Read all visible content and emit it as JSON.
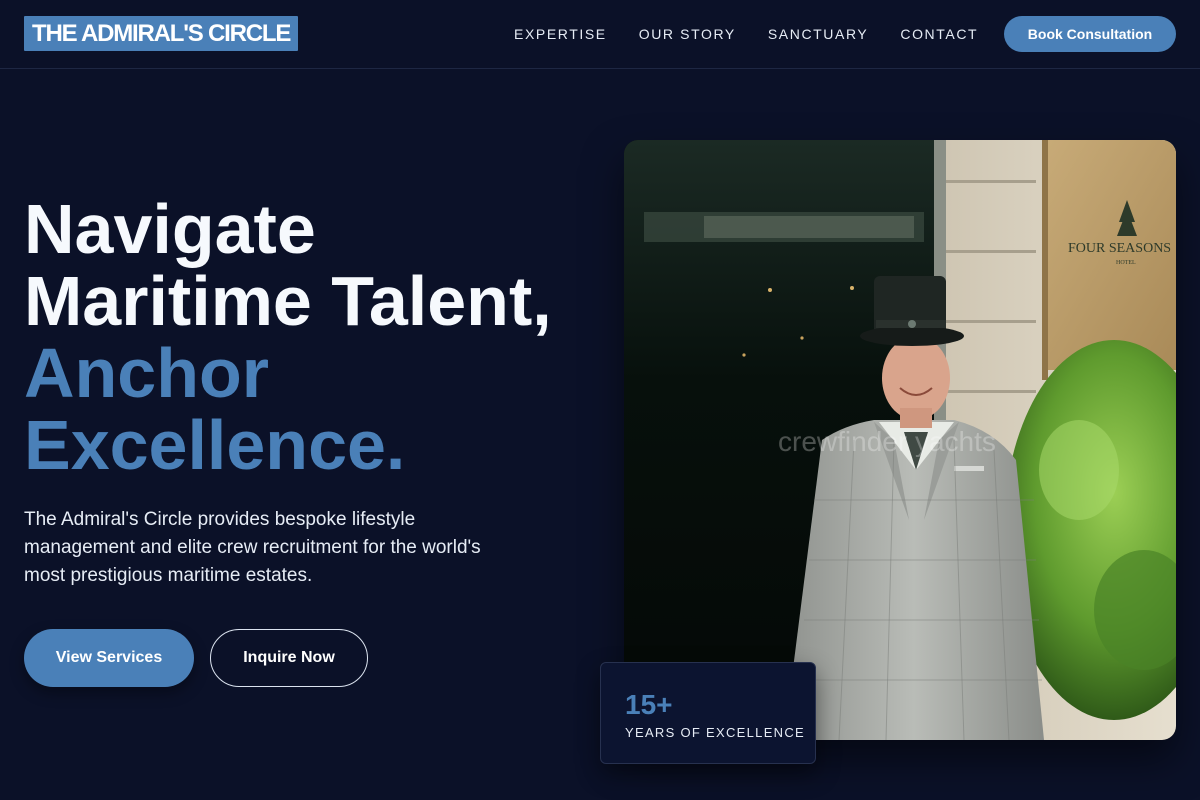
{
  "header": {
    "logo": "THE ADMIRAL'S CIRCLE",
    "nav": [
      "EXPERTISE",
      "OUR STORY",
      "SANCTUARY",
      "CONTACT"
    ],
    "cta": "Book Consultation"
  },
  "hero": {
    "title_line1": "Navigate",
    "title_line2": "Maritime Talent,",
    "accent_line1": "Anchor",
    "accent_line2": "Excellence.",
    "description": "The Admiral's Circle provides bespoke lifestyle management and elite crew recruitment for the world's most prestigious maritime estates.",
    "primary_button": "View Services",
    "secondary_button": "Inquire Now"
  },
  "photo": {
    "watermark": "crewfinder yachts",
    "sign_line1": "FOUR SEASONS",
    "sign_line2": "HOTEL"
  },
  "stat": {
    "number": "15+",
    "label": "YEARS OF EXCELLENCE"
  },
  "colors": {
    "background": "#0b1128",
    "accent": "#4a80b8",
    "text": "#f6f9fd"
  }
}
